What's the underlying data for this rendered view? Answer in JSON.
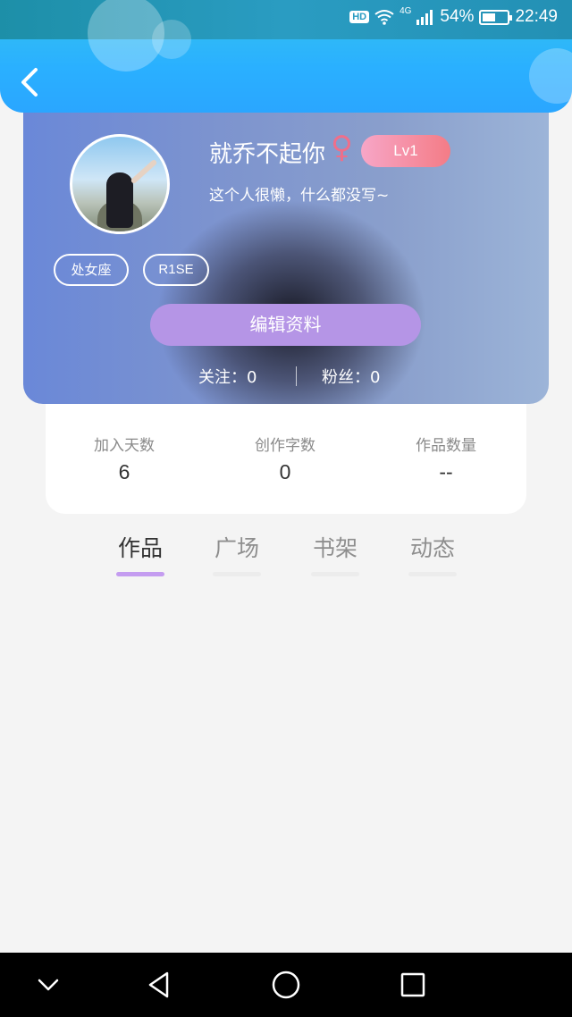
{
  "status_bar": {
    "hd": "HD",
    "network": "4G",
    "battery": "54%",
    "battery_level": 0.54,
    "time": "22:49"
  },
  "profile": {
    "name": "就乔不起你",
    "gender_symbol": "♀",
    "level": "Lv1",
    "bio": "这个人很懒，什么都没写~",
    "tags": [
      "处女座",
      "R1SE"
    ],
    "edit_button": "编辑资料",
    "following": "关注：0",
    "followers": "粉丝：0"
  },
  "stats": [
    {
      "label": "加入天数",
      "value": "6"
    },
    {
      "label": "创作字数",
      "value": "0"
    },
    {
      "label": "作品数量",
      "value": "--"
    }
  ],
  "tabs": [
    {
      "label": "作品",
      "active": true
    },
    {
      "label": "广场",
      "active": false
    },
    {
      "label": "书架",
      "active": false
    },
    {
      "label": "动态",
      "active": false
    }
  ],
  "colors": {
    "header": "#2ab0ff",
    "accent": "#b595e6",
    "female": "#ef6f8a",
    "level_badge": "#f47c86"
  },
  "icons": {
    "back": "chevron-left-icon",
    "nav": [
      "chevron-down-icon",
      "back-triangle-icon",
      "home-circle-icon",
      "recents-square-icon"
    ]
  }
}
